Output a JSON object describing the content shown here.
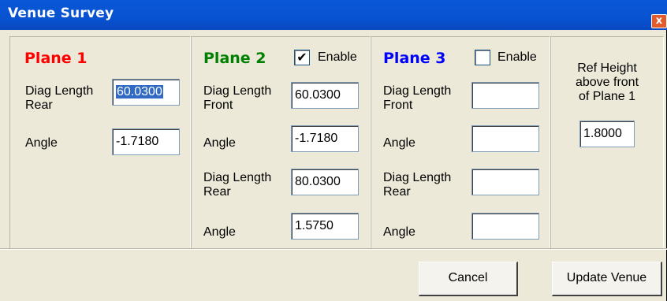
{
  "window": {
    "title": "Venue Survey",
    "close_label": "x"
  },
  "plane1": {
    "heading": "Plane 1",
    "heading_color": "#ff0000",
    "diag_rear_label_1": "Diag Length",
    "diag_rear_label_2": "Rear",
    "diag_rear_value": "60.0300",
    "angle_label": "Angle",
    "angle_value": "-1.7180"
  },
  "plane2": {
    "heading": "Plane 2",
    "heading_color": "#008000",
    "enable_label": "Enable",
    "enable_checked": true,
    "checkmark": "✔",
    "diag_front_label_1": "Diag Length",
    "diag_front_label_2": "Front",
    "diag_front_value": "60.0300",
    "angle_front_label": "Angle",
    "angle_front_value": "-1.7180",
    "diag_rear_label_1": "Diag Length",
    "diag_rear_label_2": "Rear",
    "diag_rear_value": "80.0300",
    "angle_rear_label": "Angle",
    "angle_rear_value": "1.5750"
  },
  "plane3": {
    "heading": "Plane 3",
    "heading_color": "#0000ff",
    "enable_label": "Enable",
    "enable_checked": false,
    "diag_front_label_1": "Diag Length",
    "diag_front_label_2": "Front",
    "diag_front_value": "",
    "angle_front_label": "Angle",
    "angle_front_value": "",
    "diag_rear_label_1": "Diag Length",
    "diag_rear_label_2": "Rear",
    "diag_rear_value": "",
    "angle_rear_label": "Angle",
    "angle_rear_value": ""
  },
  "ref": {
    "label_1": "Ref Height",
    "label_2": "above front",
    "label_3": "of Plane 1",
    "value": "1.8000"
  },
  "buttons": {
    "cancel": "Cancel",
    "update": "Update Venue"
  }
}
